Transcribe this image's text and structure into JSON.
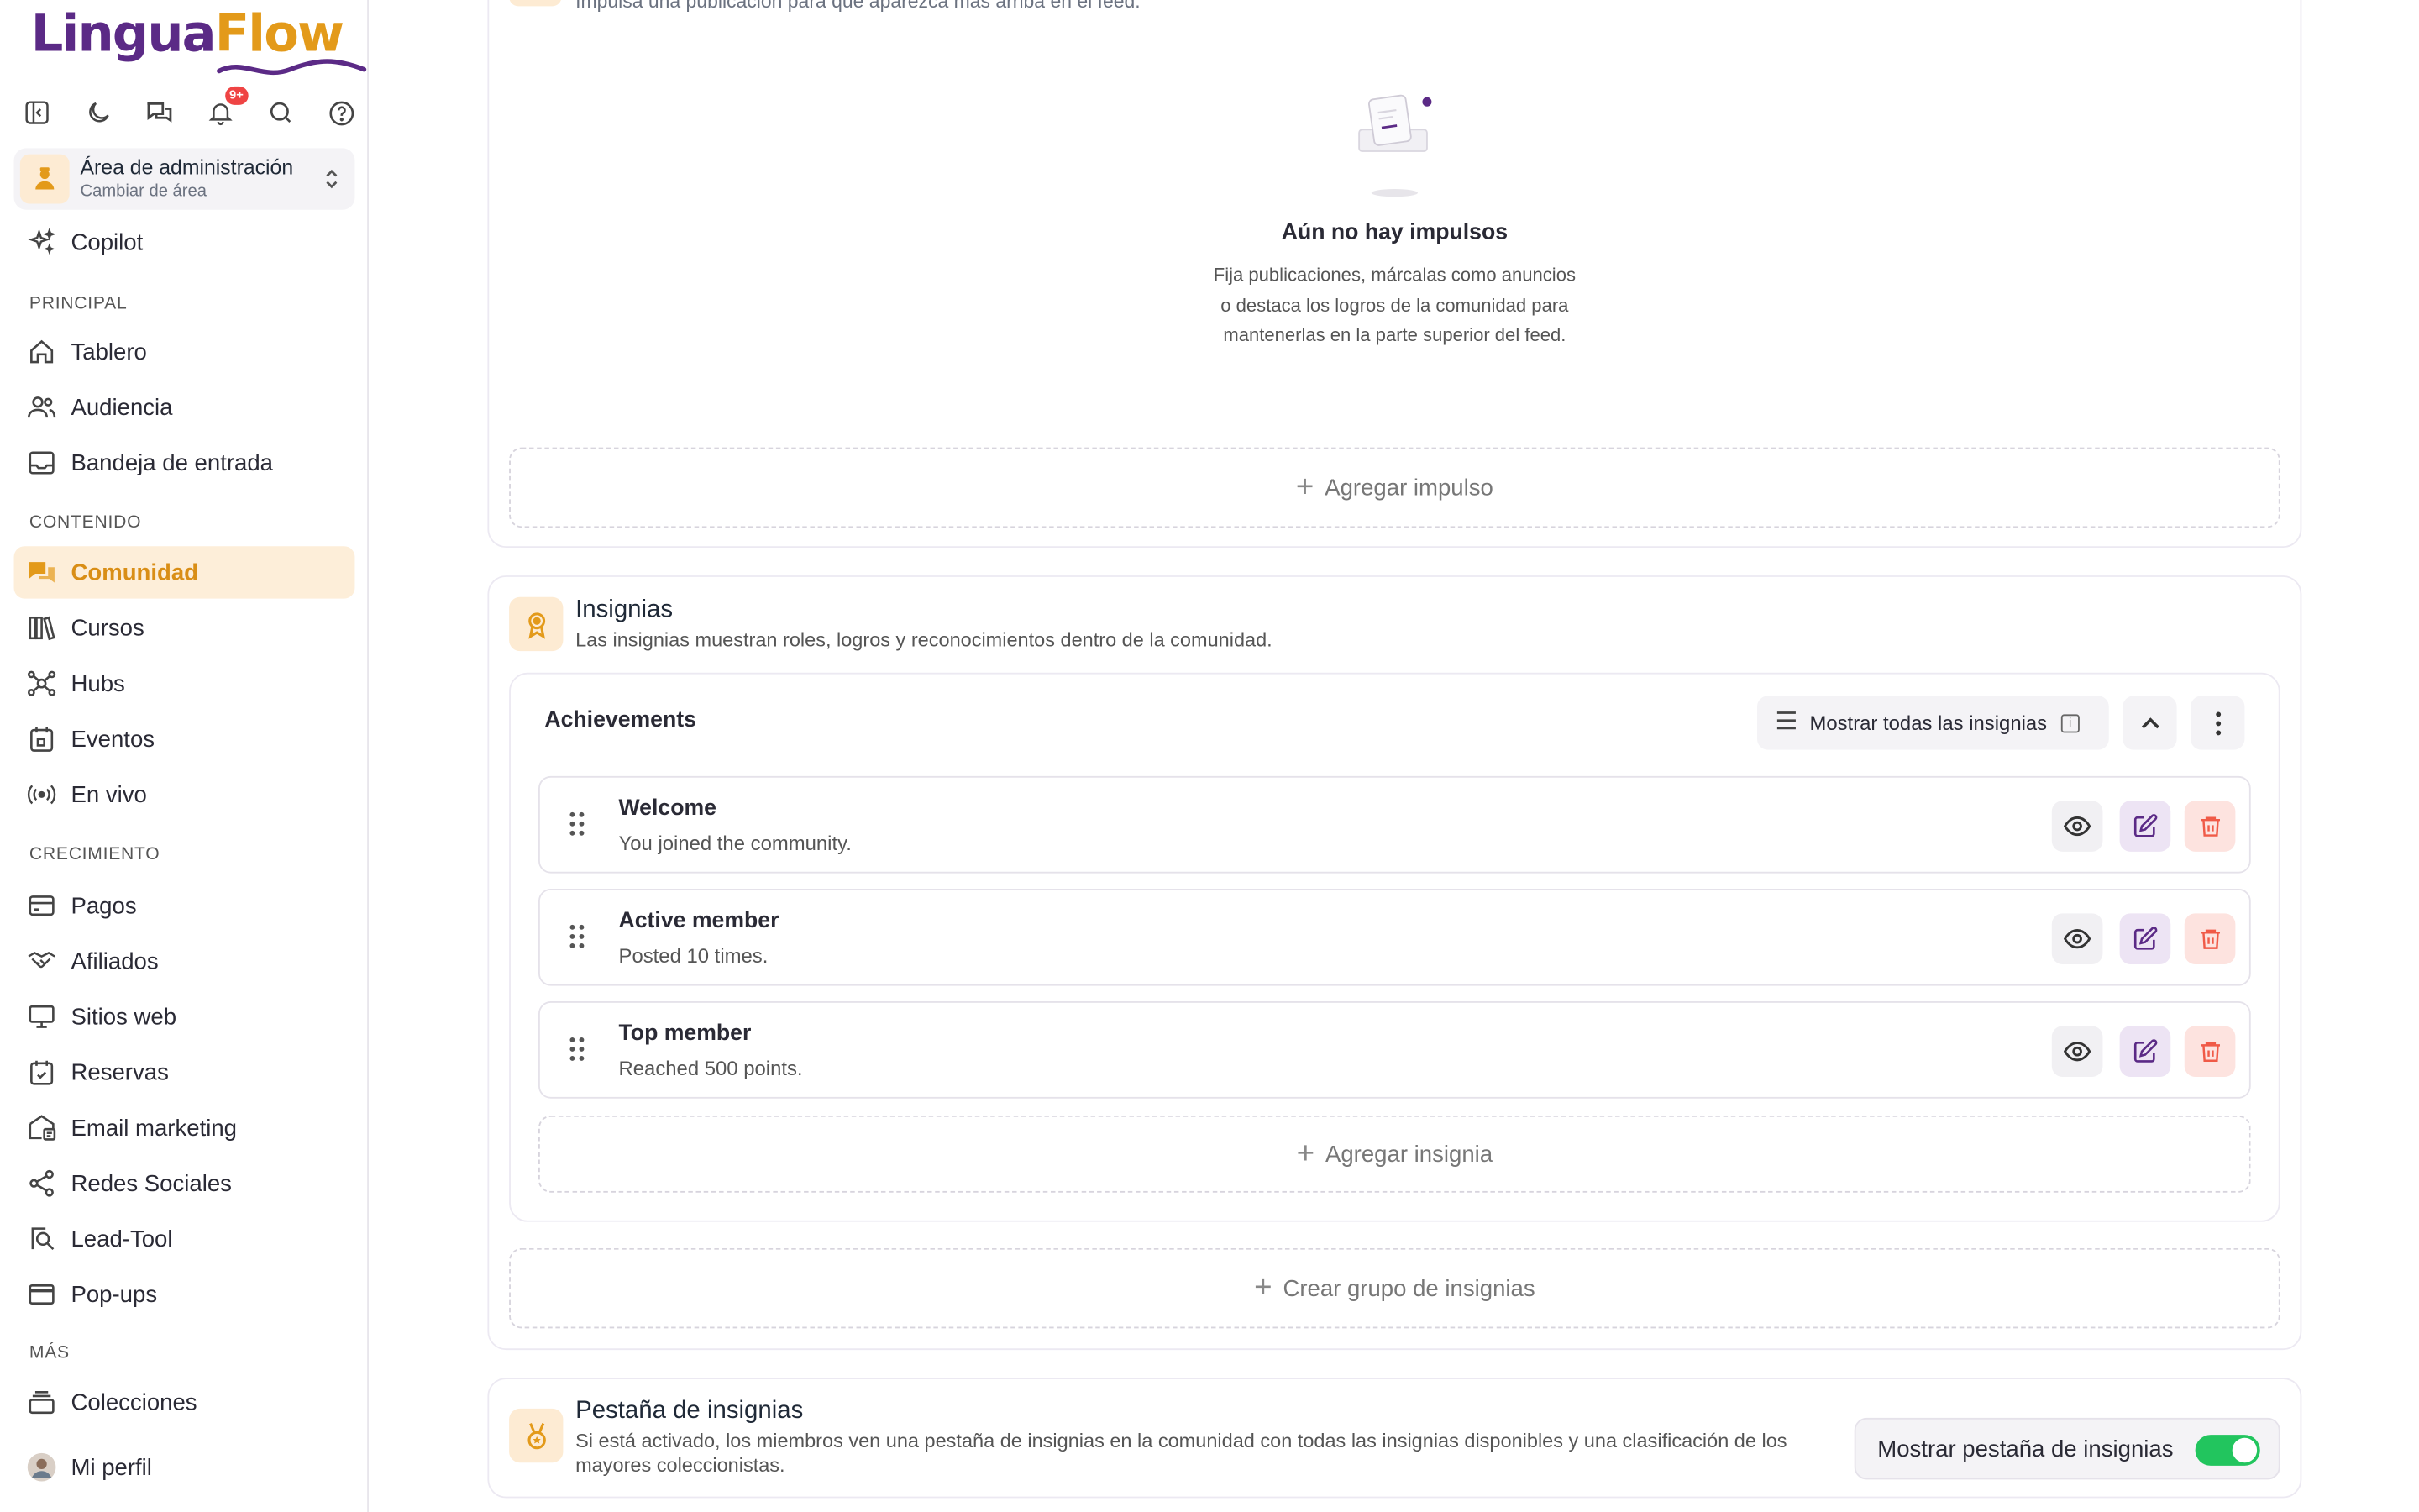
{
  "app": {
    "logo_part1": "Lingua",
    "logo_part2": "Flow",
    "notif_count": "9+"
  },
  "area": {
    "title": "Área de administración",
    "subtitle": "Cambiar de área"
  },
  "sidebar": {
    "copilot": "Copilot",
    "sections": {
      "principal": "PRINCIPAL",
      "contenido": "CONTENIDO",
      "crecimiento": "CRECIMIENTO",
      "mas": "MÁS"
    },
    "items": {
      "tablero": "Tablero",
      "audiencia": "Audiencia",
      "bandeja": "Bandeja de entrada",
      "comunidad": "Comunidad",
      "cursos": "Cursos",
      "hubs": "Hubs",
      "eventos": "Eventos",
      "envivo": "En vivo",
      "pagos": "Pagos",
      "afiliados": "Afiliados",
      "sitios": "Sitios web",
      "reservas": "Reservas",
      "email": "Email marketing",
      "redes": "Redes Sociales",
      "lead": "Lead-Tool",
      "popups": "Pop-ups",
      "colecciones": "Colecciones",
      "perfil": "Mi perfil"
    }
  },
  "boosts": {
    "cutoff_description": "Impulsa una publicación para que aparezca más arriba en el feed.",
    "empty_title": "Aún no hay impulsos",
    "empty_desc": "Fija publicaciones, márcalas como anuncios o destaca los logros de la comunidad para mantenerlas en la parte superior del feed.",
    "add_button": "Agregar impulso"
  },
  "insignias": {
    "title": "Insignias",
    "subtitle": "Las insignias muestran roles, logros y reconocimientos dentro de la comunidad.",
    "group": {
      "title": "Achievements",
      "show_all": "Mostrar todas las insignias",
      "badges": [
        {
          "name": "Welcome",
          "desc": "You joined the community."
        },
        {
          "name": "Active member",
          "desc": "Posted 10 times."
        },
        {
          "name": "Top member",
          "desc": "Reached 500 points."
        }
      ],
      "add_badge": "Agregar insignia"
    },
    "create_group": "Crear grupo de insignias"
  },
  "badge_tab": {
    "title": "Pestaña de insignias",
    "desc": "Si está activado, los miembros ven una pestaña de insignias en la comunidad con todas las insignias disponibles y una clasificación de los mayores coleccionistas.",
    "toggle_label": "Mostrar pestaña de insignias",
    "toggle_on": true
  },
  "colors": {
    "accent": "#e39a1a",
    "brand": "#5b2a86",
    "danger": "#f05a47",
    "toggle_on": "#22c55e"
  }
}
